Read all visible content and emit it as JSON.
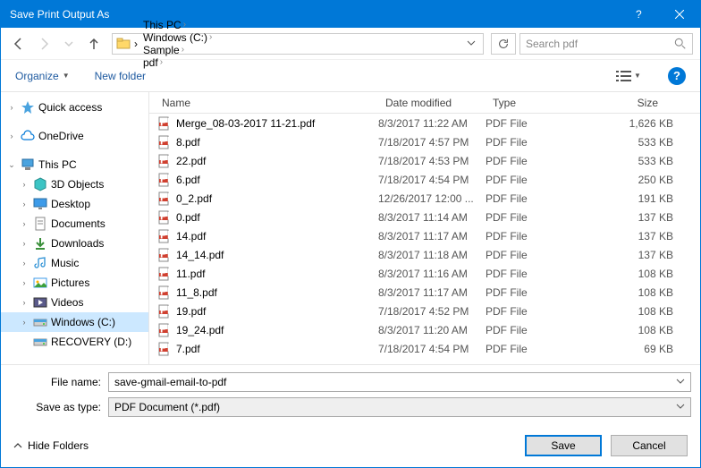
{
  "window": {
    "title": "Save Print Output As"
  },
  "breadcrumbs": [
    {
      "label": "This PC"
    },
    {
      "label": "Windows (C:)"
    },
    {
      "label": "Sample"
    },
    {
      "label": "pdf"
    }
  ],
  "search": {
    "placeholder": "Search pdf"
  },
  "commands": {
    "organize": "Organize",
    "newfolder": "New folder"
  },
  "tree": [
    {
      "label": "Quick access",
      "icon": "star",
      "expander": ">",
      "indent": 0
    },
    {
      "label": "OneDrive",
      "icon": "cloud",
      "expander": ">",
      "indent": 0
    },
    {
      "label": "This PC",
      "icon": "pc",
      "expander": "v",
      "indent": 0
    },
    {
      "label": "3D Objects",
      "icon": "cube",
      "expander": ">",
      "indent": 1
    },
    {
      "label": "Desktop",
      "icon": "desktop",
      "expander": ">",
      "indent": 1
    },
    {
      "label": "Documents",
      "icon": "doc",
      "expander": ">",
      "indent": 1
    },
    {
      "label": "Downloads",
      "icon": "down",
      "expander": ">",
      "indent": 1
    },
    {
      "label": "Music",
      "icon": "music",
      "expander": ">",
      "indent": 1
    },
    {
      "label": "Pictures",
      "icon": "pic",
      "expander": ">",
      "indent": 1
    },
    {
      "label": "Videos",
      "icon": "vid",
      "expander": ">",
      "indent": 1
    },
    {
      "label": "Windows (C:)",
      "icon": "drive",
      "expander": ">",
      "indent": 1,
      "selected": true
    },
    {
      "label": "RECOVERY (D:)",
      "icon": "drive",
      "expander": "",
      "indent": 1
    }
  ],
  "columns": {
    "name": "Name",
    "date": "Date modified",
    "type": "Type",
    "size": "Size"
  },
  "files": [
    {
      "name": "Merge_08-03-2017 11-21.pdf",
      "date": "8/3/2017 11:22 AM",
      "type": "PDF File",
      "size": "1,626 KB"
    },
    {
      "name": "8.pdf",
      "date": "7/18/2017 4:57 PM",
      "type": "PDF File",
      "size": "533 KB"
    },
    {
      "name": "22.pdf",
      "date": "7/18/2017 4:53 PM",
      "type": "PDF File",
      "size": "533 KB"
    },
    {
      "name": "6.pdf",
      "date": "7/18/2017 4:54 PM",
      "type": "PDF File",
      "size": "250 KB"
    },
    {
      "name": "0_2.pdf",
      "date": "12/26/2017 12:00 ...",
      "type": "PDF File",
      "size": "191 KB"
    },
    {
      "name": "0.pdf",
      "date": "8/3/2017 11:14 AM",
      "type": "PDF File",
      "size": "137 KB"
    },
    {
      "name": "14.pdf",
      "date": "8/3/2017 11:17 AM",
      "type": "PDF File",
      "size": "137 KB"
    },
    {
      "name": "14_14.pdf",
      "date": "8/3/2017 11:18 AM",
      "type": "PDF File",
      "size": "137 KB"
    },
    {
      "name": "11.pdf",
      "date": "8/3/2017 11:16 AM",
      "type": "PDF File",
      "size": "108 KB"
    },
    {
      "name": "11_8.pdf",
      "date": "8/3/2017 11:17 AM",
      "type": "PDF File",
      "size": "108 KB"
    },
    {
      "name": "19.pdf",
      "date": "7/18/2017 4:52 PM",
      "type": "PDF File",
      "size": "108 KB"
    },
    {
      "name": "19_24.pdf",
      "date": "8/3/2017 11:20 AM",
      "type": "PDF File",
      "size": "108 KB"
    },
    {
      "name": "7.pdf",
      "date": "7/18/2017 4:54 PM",
      "type": "PDF File",
      "size": "69 KB"
    }
  ],
  "filename": {
    "label": "File name:",
    "value": "save-gmail-email-to-pdf"
  },
  "savetype": {
    "label": "Save as type:",
    "value": "PDF Document (*.pdf)"
  },
  "actions": {
    "hidefolders": "Hide Folders",
    "save": "Save",
    "cancel": "Cancel"
  }
}
